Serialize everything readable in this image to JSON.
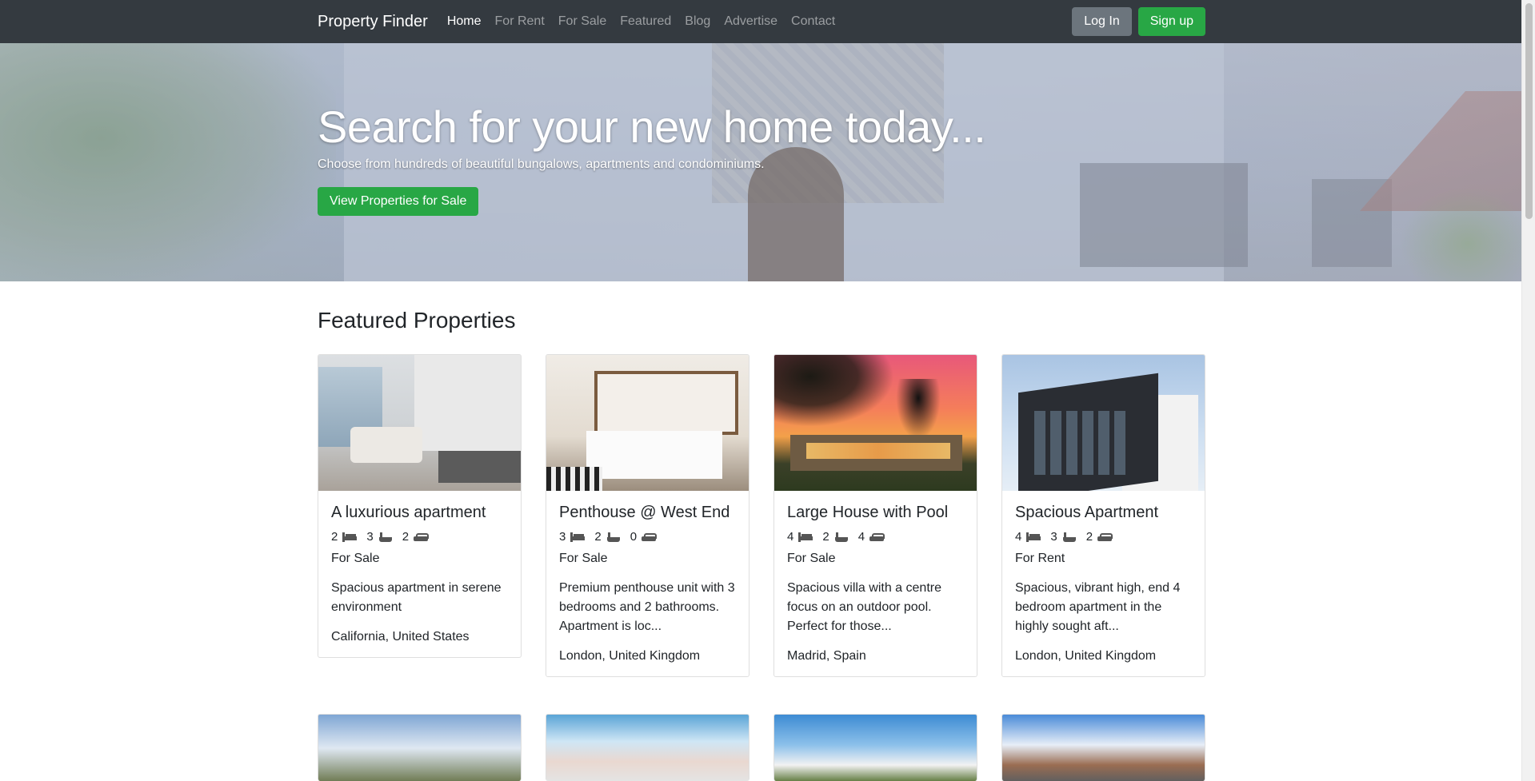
{
  "navbar": {
    "brand": "Property Finder",
    "links": [
      "Home",
      "For Rent",
      "For Sale",
      "Featured",
      "Blog",
      "Advertise",
      "Contact"
    ],
    "login_label": "Log In",
    "signup_label": "Sign up"
  },
  "hero": {
    "title": "Search for your new home today...",
    "subtitle": "Choose from hundreds of beautiful bungalows, apartments and condominiums.",
    "cta_label": "View Properties for Sale"
  },
  "featured": {
    "title": "Featured Properties",
    "cards": [
      {
        "title": "A luxurious apartment",
        "beds": "2",
        "baths": "3",
        "parking": "2",
        "status": "For Sale",
        "description": "Spacious apartment in serene environment",
        "location": "California, United States",
        "image_icon": "living-room-photo"
      },
      {
        "title": "Penthouse @ West End",
        "beds": "3",
        "baths": "2",
        "parking": "0",
        "status": "For Sale",
        "description": "Premium penthouse unit with 3 bedrooms and 2 bathrooms. Apartment is loc...",
        "location": "London, United Kingdom",
        "image_icon": "bedroom-photo"
      },
      {
        "title": "Large House with Pool",
        "beds": "4",
        "baths": "2",
        "parking": "4",
        "status": "For Sale",
        "description": "Spacious villa with a centre focus on an outdoor pool. Perfect for those...",
        "location": "Madrid, Spain",
        "image_icon": "villa-sunset-photo"
      },
      {
        "title": "Spacious Apartment",
        "beds": "4",
        "baths": "3",
        "parking": "2",
        "status": "For Rent",
        "description": "Spacious, vibrant high, end 4 bedroom apartment in the highly sought aft...",
        "location": "London, United Kingdom",
        "image_icon": "apartment-building-photo"
      }
    ]
  },
  "colors": {
    "navbar_bg": "#343a40",
    "primary_green": "#28a745",
    "secondary_gray": "#6c757d"
  }
}
